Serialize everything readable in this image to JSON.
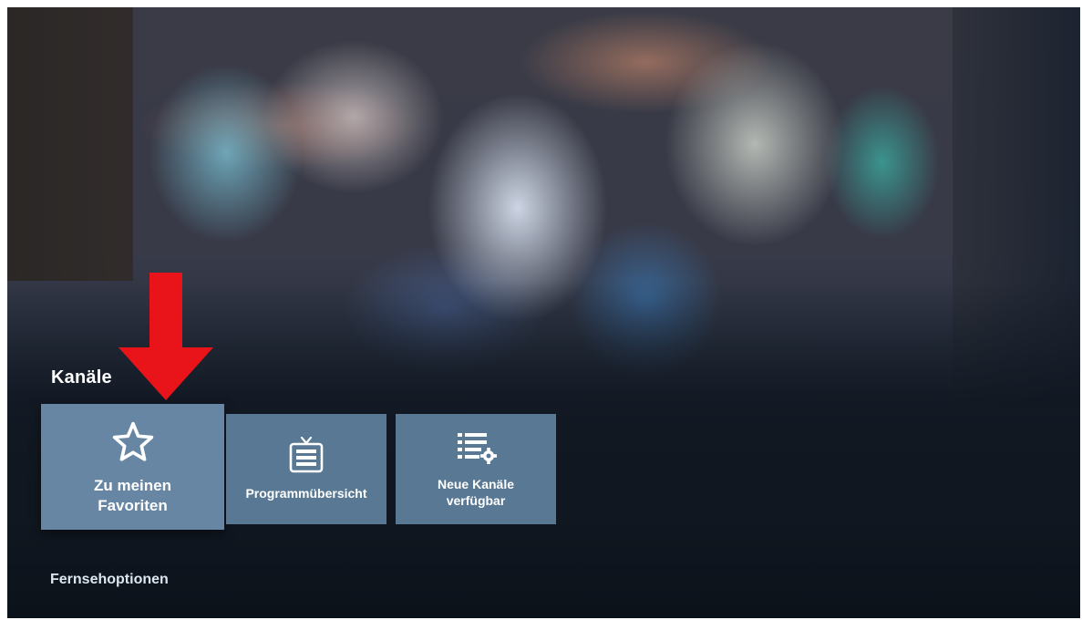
{
  "tv": {
    "channels_row": {
      "title": "Kanäle",
      "tiles": [
        {
          "label": "Zu meinen\nFavoriten",
          "icon": "star-outline-icon",
          "focused": true
        },
        {
          "label": "Programmübersicht",
          "icon": "tv-guide-icon",
          "focused": false
        },
        {
          "label": "Neue Kanäle\nverfügbar",
          "icon": "channel-list-settings-icon",
          "focused": false
        }
      ]
    },
    "next_section": {
      "title": "Fernsehoptionen"
    }
  },
  "annotation": {
    "arrow_color": "#e8141a"
  },
  "colors": {
    "tile_focused": "#6686a3",
    "tile": "#587893",
    "text": "#ffffff"
  }
}
